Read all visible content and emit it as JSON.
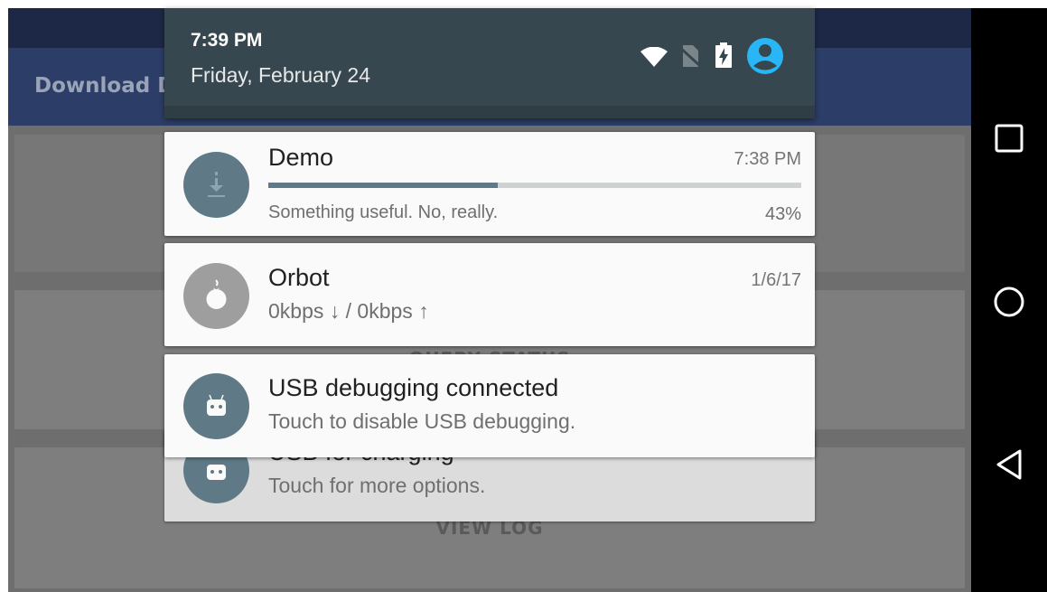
{
  "app": {
    "title": "Download De",
    "buttons": [
      "QUERY STATUS",
      "VIEW LOG"
    ]
  },
  "shade": {
    "time": "7:39 PM",
    "date": "Friday, February 24",
    "status_icons": [
      "wifi-icon",
      "no-sim-icon",
      "battery-charging-icon",
      "account-icon"
    ],
    "accent_color": "#29b6f6"
  },
  "notifications": [
    {
      "app": "Demo",
      "title": "Demo",
      "text": "Something useful. No, really.",
      "time": "7:38 PM",
      "progress_percent": 43,
      "progress_label": "43%",
      "icon": "download-icon",
      "icon_color": "#5f7a86"
    },
    {
      "title": "Orbot",
      "text": "0kbps ↓ / 0kbps ↑",
      "time": "1/6/17",
      "icon": "onion-icon",
      "icon_color": "#9e9e9e"
    },
    {
      "title": "USB debugging connected",
      "text": "Touch to disable USB debugging.",
      "icon": "android-icon",
      "icon_color": "#5f7a86"
    },
    {
      "title": "USB for charging",
      "text": "Touch for more options.",
      "icon": "android-icon",
      "icon_color": "#5f7a86"
    }
  ],
  "navbar": {
    "buttons": [
      "recents-button",
      "home-button",
      "back-button"
    ]
  }
}
